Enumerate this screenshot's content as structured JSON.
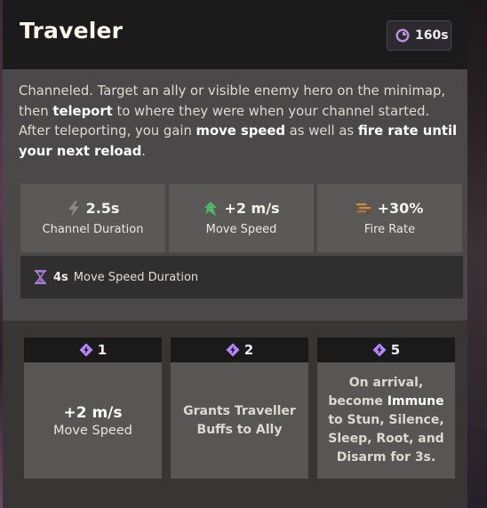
{
  "ability": {
    "name": "Traveler",
    "cooldown": "160s",
    "cooldown_icon": "cooldown-clock-icon",
    "description": {
      "t1": "Channeled. Target an ally or visible enemy hero on the minimap, then ",
      "b1": "teleport",
      "t2": " to where they were when your channel started. After teleporting, you gain ",
      "b2": "move speed",
      "t3": " as well as ",
      "b3": "fire rate until your next reload",
      "t4": "."
    }
  },
  "stats": [
    {
      "value": "2.5s",
      "label": "Channel Duration",
      "icon": "lightning-icon",
      "color": "#8e8c8a"
    },
    {
      "value": "+2 m/s",
      "label": "Move Speed",
      "icon": "move-speed-icon",
      "color": "#4fb36a"
    },
    {
      "value": "+30%",
      "label": "Fire Rate",
      "icon": "fire-rate-icon",
      "color": "#d0893d"
    }
  ],
  "sub_stat": {
    "value": "4s",
    "label": "Move Speed Duration",
    "icon": "hourglass-icon",
    "color": "#a579d1"
  },
  "upgrades": [
    {
      "cost": "1",
      "value": "+2 m/s",
      "label": "Move Speed"
    },
    {
      "cost": "2",
      "text": "Grants Traveller Buffs to Ally"
    },
    {
      "cost": "5",
      "t1": "On arrival, become ",
      "b1": "Immune",
      "t2": " to Stun, Silence, Sleep, Root, and Disarm for 3s."
    }
  ],
  "colors": {
    "header_bg": "#1b1b1b",
    "panel_bg": "#4a4848",
    "upgrade_icon": "#b287ff"
  }
}
